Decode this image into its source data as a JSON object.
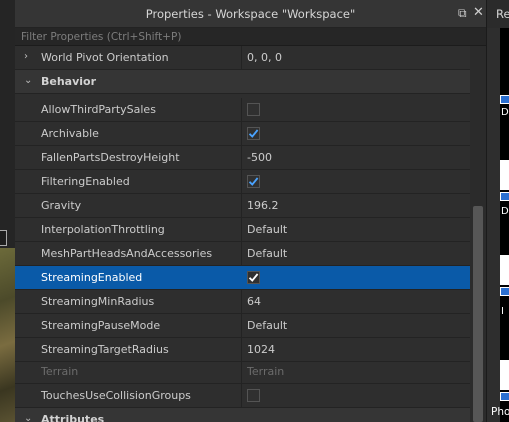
{
  "window": {
    "title": "Properties - Workspace \"Workspace\"",
    "dock_icon": "⧉",
    "close_icon": "✕"
  },
  "filter": {
    "placeholder": "Filter Properties (Ctrl+Shift+P)"
  },
  "rows": [
    {
      "name": "World Pivot Orientation",
      "value": "0, 0, 0",
      "type": "text",
      "expander": "›"
    },
    {
      "name": "Behavior",
      "type": "category",
      "expander": "⌄"
    },
    {
      "name": "AllowThirdPartySales",
      "type": "checkbox",
      "checked": false
    },
    {
      "name": "Archivable",
      "type": "checkbox",
      "checked": true
    },
    {
      "name": "FallenPartsDestroyHeight",
      "value": "-500",
      "type": "text"
    },
    {
      "name": "FilteringEnabled",
      "type": "checkbox",
      "checked": true
    },
    {
      "name": "Gravity",
      "value": "196.2",
      "type": "text"
    },
    {
      "name": "InterpolationThrottling",
      "value": "Default",
      "type": "text"
    },
    {
      "name": "MeshPartHeadsAndAccessories",
      "value": "Default",
      "type": "text"
    },
    {
      "name": "StreamingEnabled",
      "type": "checkbox",
      "checked": true,
      "selected": true
    },
    {
      "name": "StreamingMinRadius",
      "value": "64",
      "type": "text"
    },
    {
      "name": "StreamingPauseMode",
      "value": "Default",
      "type": "text"
    },
    {
      "name": "StreamingTargetRadius",
      "value": "1024",
      "type": "text"
    },
    {
      "name": "Terrain",
      "value": "Terrain",
      "type": "text",
      "disabled": true
    },
    {
      "name": "TouchesUseCollisionGroups",
      "type": "checkbox",
      "checked": false
    },
    {
      "name": "Attributes",
      "type": "category",
      "expander": "⌄"
    }
  ],
  "right_panel": {
    "header": "Re",
    "labels": [
      "D",
      "D",
      "I",
      "Pho"
    ]
  },
  "colors": {
    "selection": "#0a5aa8",
    "check": "#4aa3ff",
    "panel_bg": "#2e2e2e"
  }
}
